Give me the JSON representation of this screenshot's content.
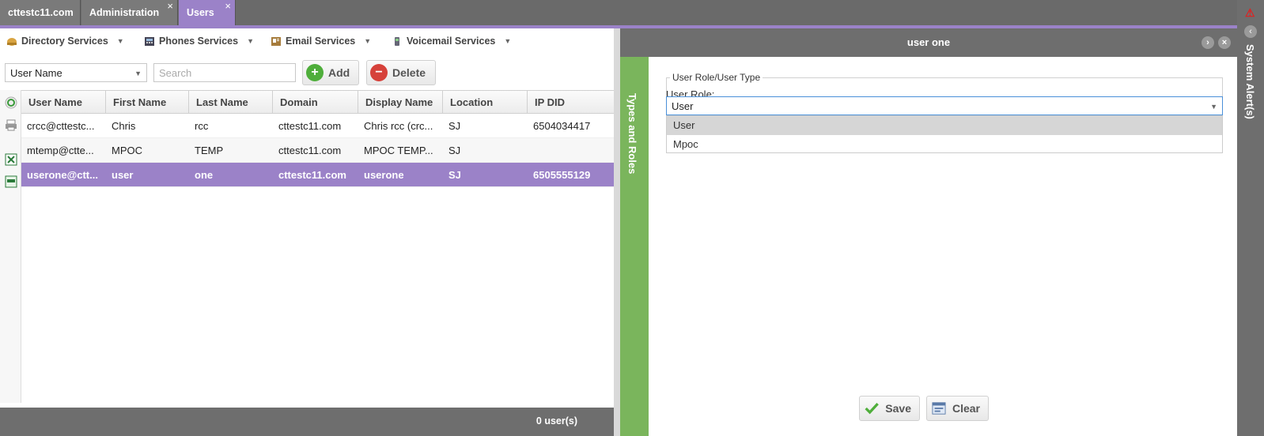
{
  "tabs": [
    {
      "label": "cttestc11.com",
      "closable": false,
      "active": false
    },
    {
      "label": "Administration",
      "closable": true,
      "active": false
    },
    {
      "label": "Users",
      "closable": true,
      "active": true
    }
  ],
  "tab_close_glyph": "×",
  "services": [
    {
      "label": "Directory Services",
      "icon": "directory-icon"
    },
    {
      "label": "Phones Services",
      "icon": "phone-icon"
    },
    {
      "label": "Email Services",
      "icon": "email-icon"
    },
    {
      "label": "Voicemail Services",
      "icon": "voicemail-icon"
    }
  ],
  "filter": {
    "selected": "User Name",
    "search_placeholder": "Search"
  },
  "buttons": {
    "add": "Add",
    "delete": "Delete",
    "save": "Save",
    "clear": "Clear"
  },
  "grid": {
    "columns": [
      "User Name",
      "First Name",
      "Last Name",
      "Domain",
      "Display Name",
      "Location",
      "IP DID"
    ],
    "rows": [
      [
        "crcc@cttestc...",
        "Chris",
        "rcc",
        "cttestc11.com",
        "Chris rcc (crc...",
        "SJ",
        "6504034417"
      ],
      [
        "mtemp@ctte...",
        "MPOC",
        "TEMP",
        "cttestc11.com",
        "MPOC TEMP...",
        "SJ",
        ""
      ],
      [
        "userone@ctt...",
        "user",
        "one",
        "cttestc11.com",
        "userone",
        "SJ",
        "6505555129"
      ]
    ],
    "selected_row": 2,
    "footer": "0 user(s)"
  },
  "detail": {
    "title": "user one",
    "side_tab": "Types and Roles",
    "section_legend": "User Role/User Type",
    "role_label": "User Role:",
    "role_value": "User",
    "role_options": [
      "User",
      "Mpoc"
    ],
    "highlighted_option": "User"
  },
  "alerts": {
    "label": "System Alert(s)"
  },
  "colors": {
    "accent": "#9b82c8",
    "side_tab": "#7ab55c",
    "chrome": "#6e6e6e"
  }
}
